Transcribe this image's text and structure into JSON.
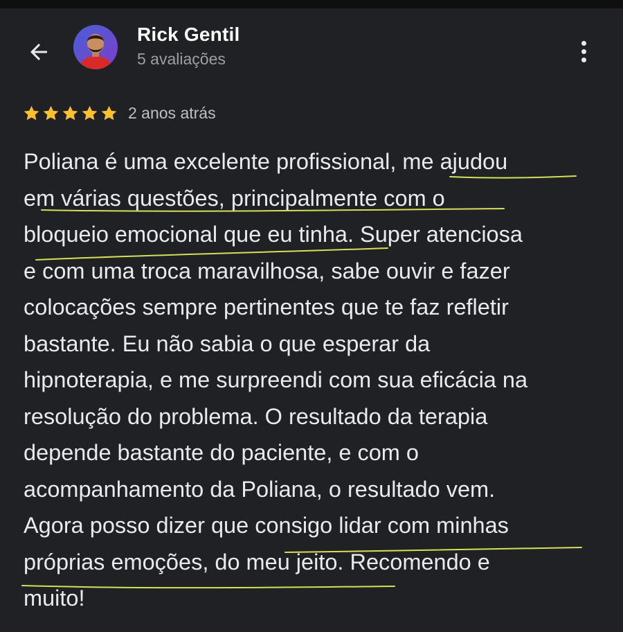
{
  "header": {
    "back_icon": "arrow-left-icon",
    "user_name": "Rick Gentil",
    "review_count": "5 avaliações",
    "menu_icon": "more-vert-icon"
  },
  "review": {
    "rating": 5,
    "rating_max": 5,
    "star_color": "#fbc02d",
    "time": "2 anos atrás",
    "lines": [
      "Poliana é uma excelente profissional, me ajudou",
      "em várias questões, principalmente com o",
      "bloqueio emocional que eu tinha. Super atenciosa",
      "e com uma troca maravilhosa, sabe ouvir e fazer",
      "colocações sempre pertinentes que te faz refletir",
      "bastante. Eu não sabia o que esperar da",
      "hipnoterapia, e me surpreendi com sua eficácia na",
      "resolução do problema. O resultado da terapia",
      "depende bastante do paciente, e com o",
      "acompanhamento da Poliana, o resultado vem.",
      "Agora posso dizer que consigo lidar com minhas",
      "próprias emoções, do meu jeito. Recomendo e",
      "muito!"
    ]
  },
  "annotation_color": "#d4e157"
}
